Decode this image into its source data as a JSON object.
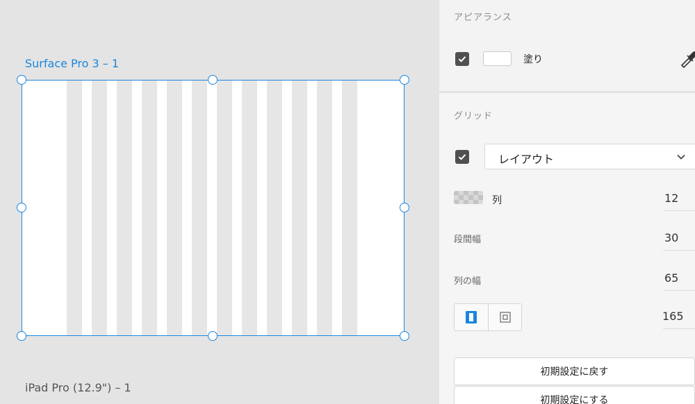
{
  "canvas": {
    "artboard_name": "Surface Pro 3 – 1",
    "next_artboard_name": "iPad Pro (12.9\") – 1",
    "grid_column_count": 12
  },
  "panel": {
    "appearance": {
      "title": "アピアランス",
      "fill_label": "塗り",
      "fill_color": "#ffffff",
      "fill_enabled": true
    },
    "grid": {
      "title": "グリッド",
      "enabled": true,
      "type_select": "レイアウト",
      "columns_label": "列",
      "columns_value": "12",
      "gutter_label": "段間幅",
      "gutter_value": "30",
      "column_width_label": "列の幅",
      "column_width_value": "65",
      "margin_value": "165",
      "reset_button": "初期設定に戻す",
      "set_default_button": "初期設定にする"
    }
  },
  "colors": {
    "selection_accent": "#1a86dd",
    "grid_column": "#e6e6e6",
    "canvas_bg": "#e4e4e4"
  },
  "icons": {
    "checkbox": "check-icon",
    "eyedropper": "eyedropper-icon",
    "dropdown": "chevron-down-icon",
    "grid_swatch": "grid-color-swatch",
    "mode_left": "uniform-margin-icon",
    "mode_right": "custom-margin-icon"
  }
}
